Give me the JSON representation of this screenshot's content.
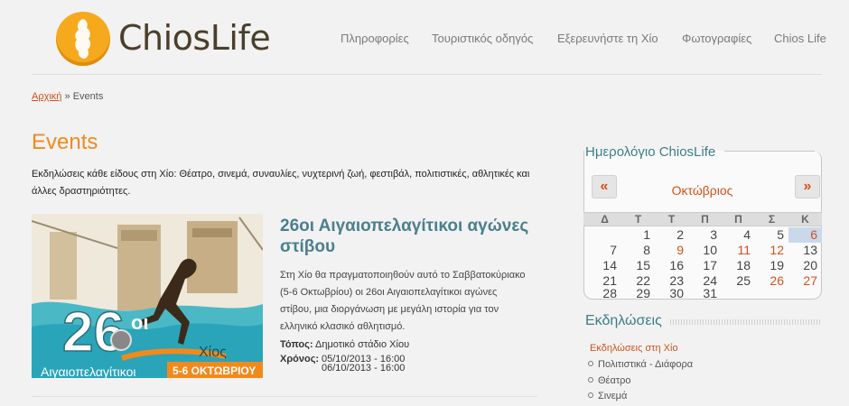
{
  "header": {
    "logo_text": "ChiosLife",
    "nav": [
      "Πληροφορίες",
      "Τουριστικός οδηγός",
      "Εξερευνήστε τη Χίο",
      "Φωτογραφίες",
      "Chios Life"
    ]
  },
  "breadcrumb": {
    "home": "Αρχική",
    "sep": "»",
    "current": "Events"
  },
  "main": {
    "title": "Events",
    "intro": "Εκδηλώσεις κάθε είδους στη Χίο: Θέατρο, σινεμά, συναυλίες, νυχτερινή ζωή, φεστιβάλ, πολιτιστικές, αθλητικές και άλλες δραστηριότητες.",
    "event": {
      "title": "26οι Αιγαιοπελαγίτικοι αγώνες στίβου",
      "desc": "Στη Χίο θα πραγματοποιηθούν αυτό το Σαββατοκύριακο (5-6 Οκτωβρίου) οι 26οι Αιγαιοπελαγίτικοι αγώνες στίβου, μια διοργάνωση με μεγάλη ιστορία για τον ελληνικό κλασικό αθλητισμό.",
      "place_label": "Τόπος:",
      "place": "Δημοτικό στάδιο Χίου",
      "time_label": "Χρόνος:",
      "time_start": "05/10/2013 - 16:00",
      "time_end": "06/10/2013 - 16:00",
      "poster": {
        "number": "26",
        "suffix": "οι",
        "place": "Χίος",
        "dates": "5-6 ΟΚΤΩΒΡΙΟΥ",
        "name": "Αιγαιοπελαγίτικοι"
      }
    }
  },
  "calendar": {
    "title": "Ημερολόγιο ChiosLife",
    "prev": "«",
    "next": "»",
    "month": "Οκτώβριος",
    "weekdays": [
      "Δ",
      "Τ",
      "Τ",
      "Π",
      "Π",
      "Σ",
      "Κ"
    ],
    "weeks": [
      [
        "",
        "1",
        "2",
        "3",
        "4",
        "5",
        "6"
      ],
      [
        "7",
        "8",
        "9",
        "10",
        "11",
        "12",
        "13"
      ],
      [
        "14",
        "15",
        "16",
        "17",
        "18",
        "19",
        "20"
      ],
      [
        "21",
        "22",
        "23",
        "24",
        "25",
        "26",
        "27"
      ],
      [
        "28",
        "29",
        "30",
        "31",
        "",
        "",
        ""
      ]
    ],
    "highlighted": [
      "6",
      "9",
      "11",
      "12",
      "26",
      "27"
    ],
    "today": "6"
  },
  "events_sidebar": {
    "title": "Εκδηλώσεις",
    "category": "Εκδηλώσεις στη Χίο",
    "items": [
      "Πολιτιστικά - Διάφορα",
      "Θέατρο",
      "Σινεμά"
    ]
  },
  "colors": {
    "accent": "#f18a1c",
    "link": "#d6501a",
    "teal": "#3d7d86"
  }
}
